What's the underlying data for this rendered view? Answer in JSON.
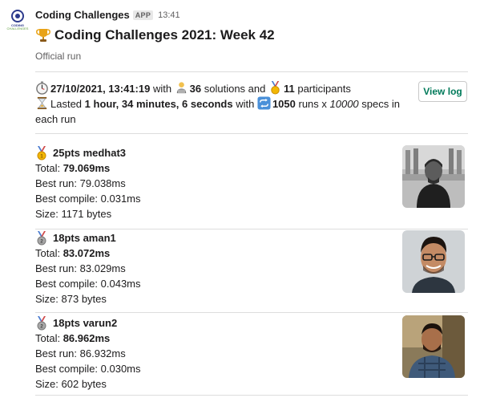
{
  "message": {
    "sender": "Coding Challenges",
    "app_badge": "APP",
    "timestamp": "13:41",
    "title": "Coding Challenges 2021: Week 42",
    "subtitle": "Official run",
    "view_log_label": "View log"
  },
  "avatar": {
    "line1": "CODING",
    "line2": "CHALLENGES"
  },
  "summary": {
    "datetime": "27/10/2021, 13:41:19",
    "with_text": " with ",
    "solutions_count": "36",
    "solutions_text": " solutions and ",
    "participants_count": "11",
    "participants_text": " participants",
    "lasted_prefix": "Lasted ",
    "duration": "1 hour, 34 minutes, 6 seconds",
    "with_text2": " with ",
    "runs_count": "1050",
    "runs_text": " runs x ",
    "specs_count": "10000",
    "specs_text": " specs in each run"
  },
  "entries": [
    {
      "medal": "gold-medal",
      "header": "25pts medhat3",
      "total_label": "Total: ",
      "total": "79.069ms",
      "best_run": "Best run: 79.038ms",
      "best_compile": "Best compile: 0.031ms",
      "size": "Size: 1171 bytes"
    },
    {
      "medal": "silver-medal",
      "header": "18pts aman1",
      "total_label": "Total: ",
      "total": "83.072ms",
      "best_run": "Best run: 83.029ms",
      "best_compile": "Best compile: 0.043ms",
      "size": "Size: 873 bytes"
    },
    {
      "medal": "silver-medal",
      "header": "18pts varun2",
      "total_label": "Total: ",
      "total": "86.962ms",
      "best_run": "Best run: 86.932ms",
      "best_compile": "Best compile: 0.030ms",
      "size": "Size: 602 bytes"
    }
  ],
  "colors": {
    "link_green": "#007a5a",
    "muted": "#616061",
    "text": "#1d1c1d",
    "gold": "#f2b705",
    "silver": "#a8a8a8"
  }
}
